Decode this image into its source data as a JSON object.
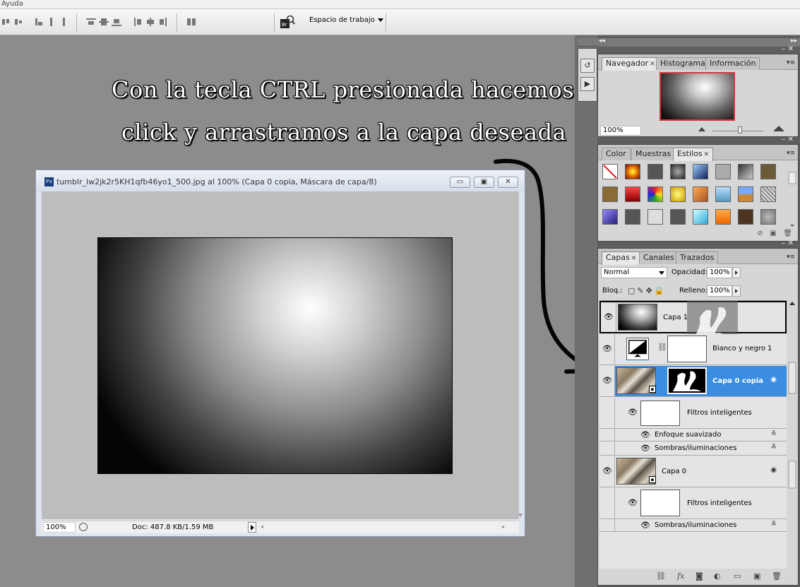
{
  "menu": {
    "ayuda": "Ayuda"
  },
  "toolbar": {
    "workspace_label": "Espacio de trabajo"
  },
  "overlay": {
    "line1": "Con la tecla CTRL presionada hacemos",
    "line2": "click y arrastramos a la capa deseada"
  },
  "document": {
    "title": "tumblr_lw2jk2r5KH1qfb46yo1_500.jpg al 100% (Capa 0 copia, Máscara de capa/8)",
    "zoom": "100%",
    "doc_info": "Doc: 487.8 KB/1.59 MB"
  },
  "navigator": {
    "tabs": [
      "Navegador",
      "Histograma",
      "Información"
    ],
    "zoom": "100%"
  },
  "styles": {
    "tabs": [
      "Color",
      "Muestras",
      "Estilos"
    ]
  },
  "layers": {
    "tabs": [
      "Capas",
      "Canales",
      "Trazados"
    ],
    "blend_mode": "Normal",
    "opacity_label": "Opacidad:",
    "opacity_value": "100%",
    "lock_label": "Bloq.:",
    "fill_label": "Relleno:",
    "fill_value": "100%",
    "items": [
      {
        "name": "Capa 1"
      },
      {
        "name": "Blanco y negro 1"
      },
      {
        "name": "Capa 0 copia"
      },
      {
        "name": "Filtros inteligentes"
      },
      {
        "name": "Enfoque suavizado"
      },
      {
        "name": "Sombras/iluminaciones"
      },
      {
        "name": "Capa 0"
      },
      {
        "name": "Filtros inteligentes"
      },
      {
        "name": "Sombras/iluminaciones"
      }
    ]
  },
  "icons": {
    "eye": "eye-icon",
    "chain": "chain-link-icon",
    "fx": "fx-icon",
    "trash": "trash-icon"
  }
}
